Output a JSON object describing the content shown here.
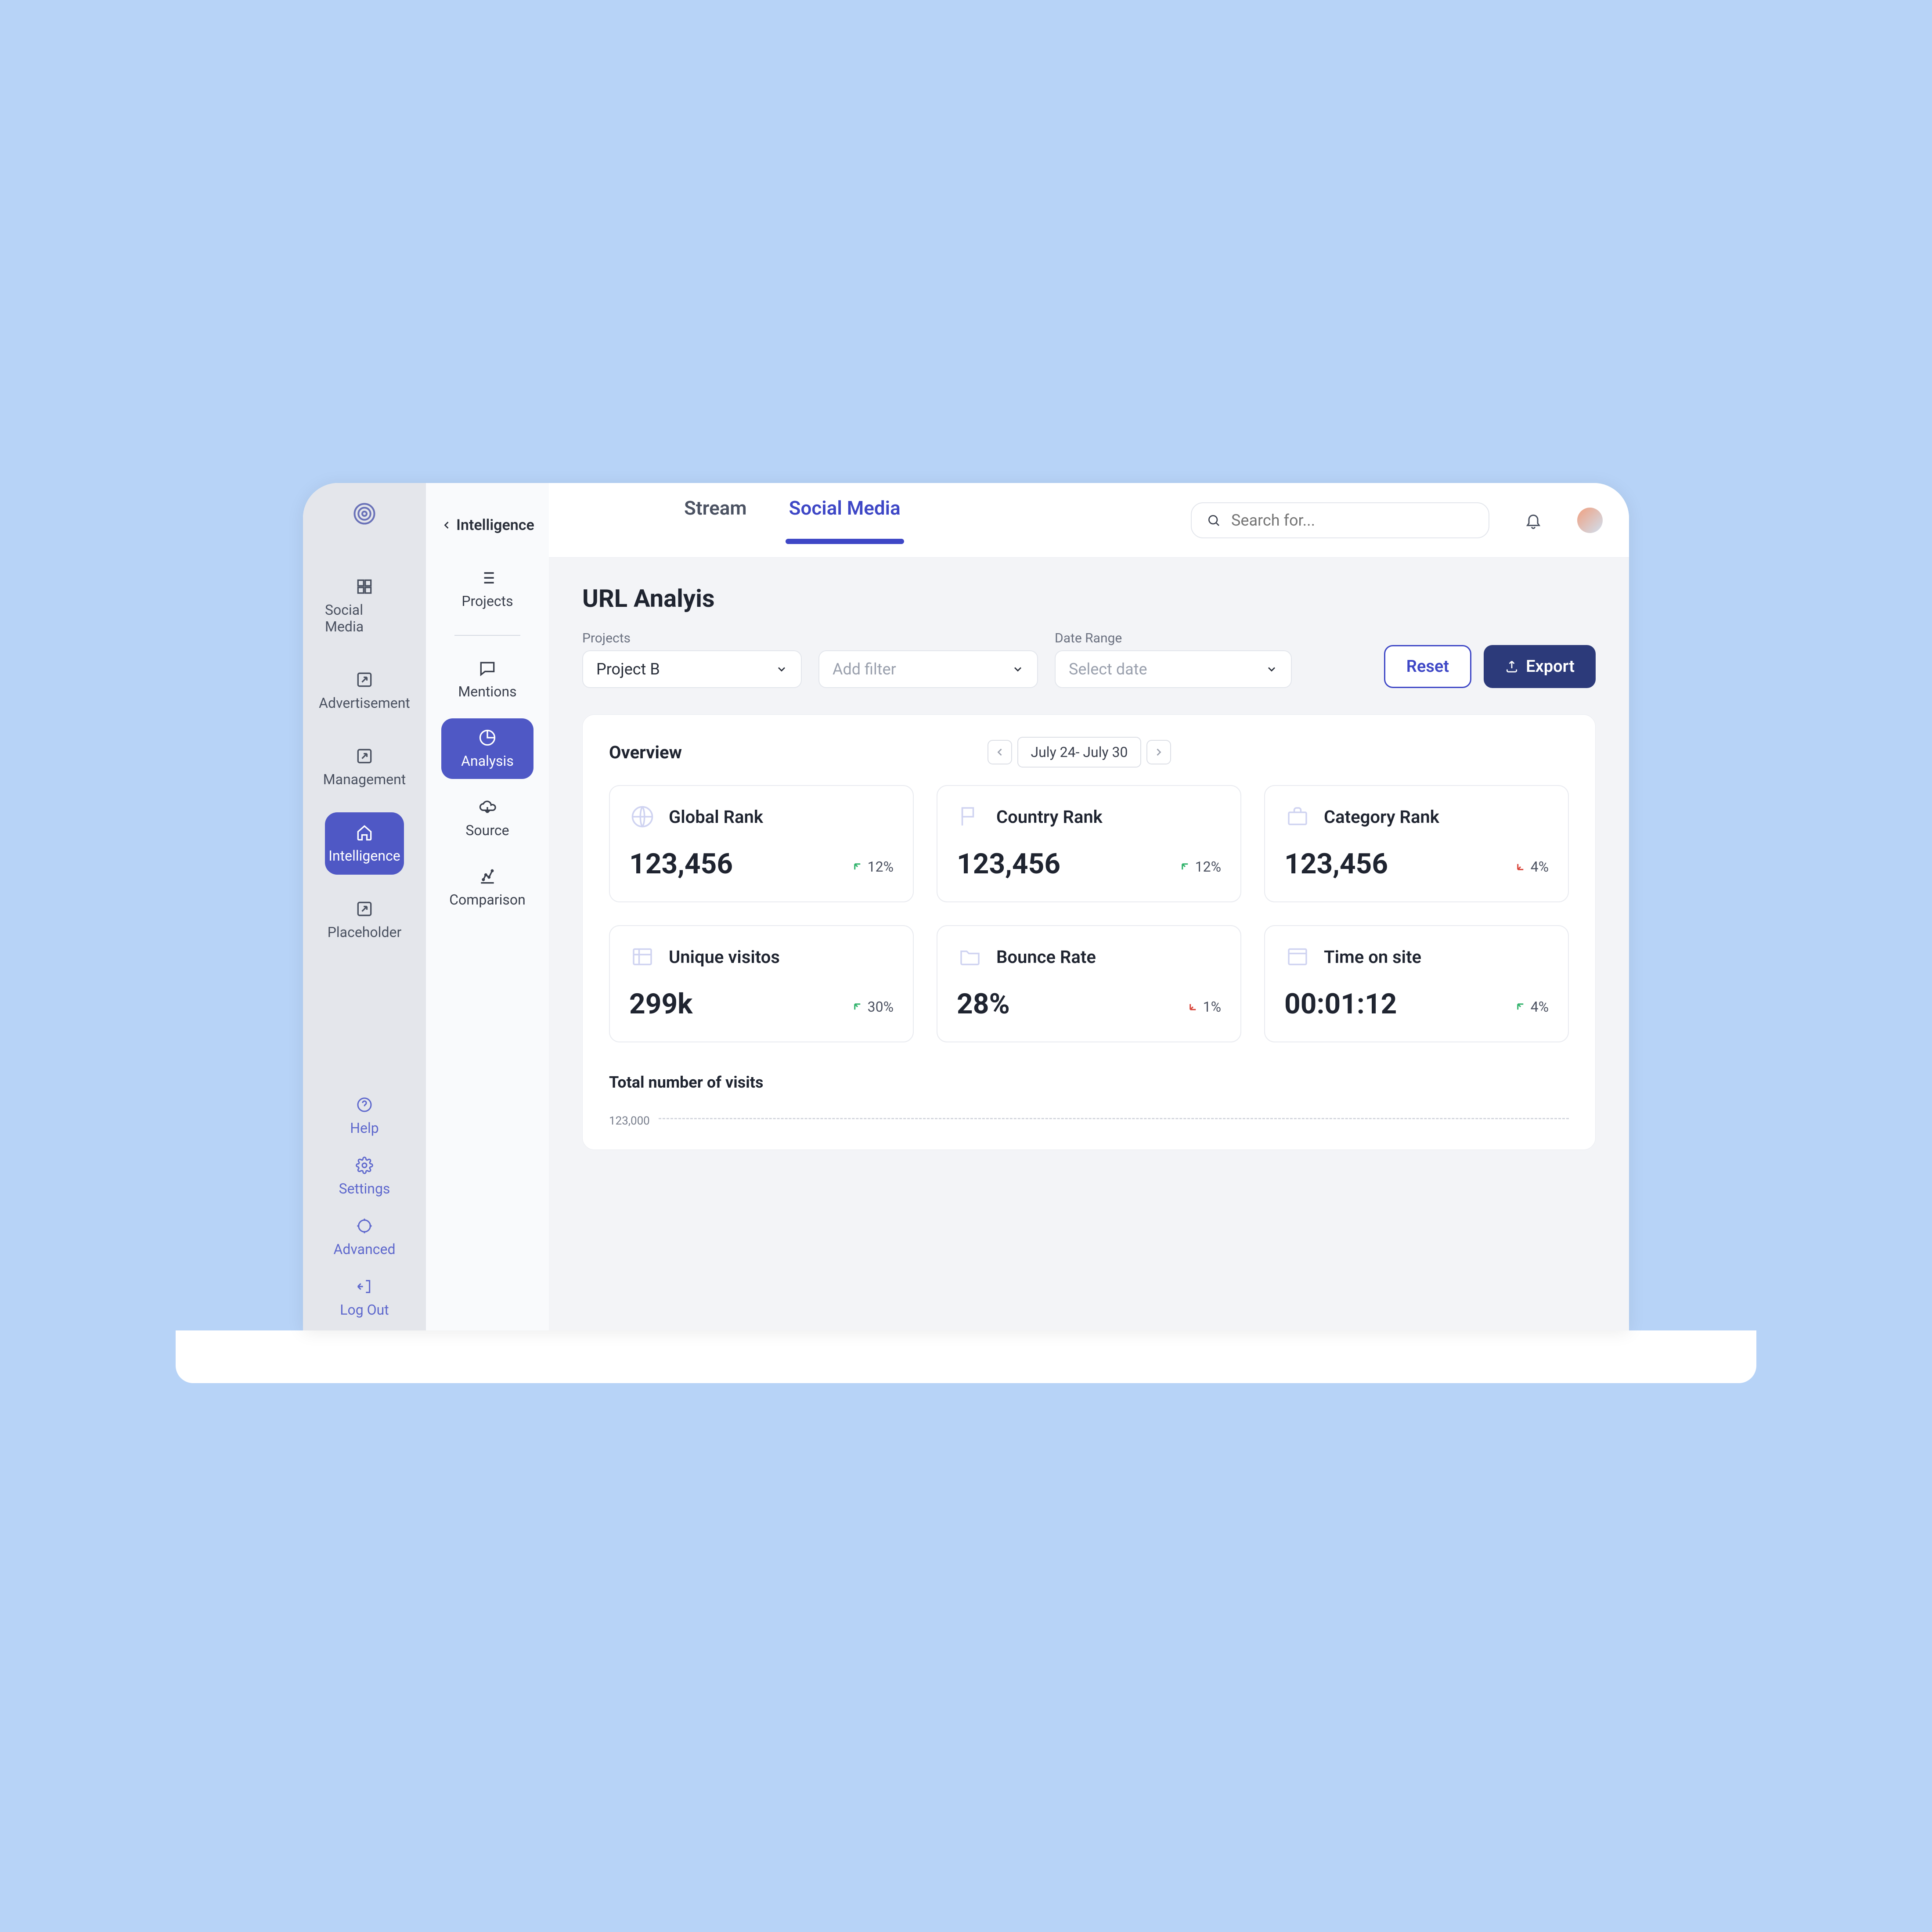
{
  "primarySidebar": {
    "items": [
      {
        "label": "Social Media"
      },
      {
        "label": "Advertisement"
      },
      {
        "label": "Management"
      },
      {
        "label": "Intelligence"
      },
      {
        "label": "Placeholder"
      }
    ],
    "footer": [
      {
        "label": "Help"
      },
      {
        "label": "Settings"
      },
      {
        "label": "Advanced"
      },
      {
        "label": "Log Out"
      }
    ]
  },
  "secondarySidebar": {
    "backLabel": "Intelligence",
    "items": [
      {
        "label": "Projects"
      },
      {
        "label": "Mentions"
      },
      {
        "label": "Analysis"
      },
      {
        "label": "Source"
      },
      {
        "label": "Comparison"
      }
    ]
  },
  "topbar": {
    "tabs": [
      {
        "label": "Stream"
      },
      {
        "label": "Social Media"
      }
    ],
    "searchPlaceholder": "Search for..."
  },
  "page": {
    "title": "URL Analyis",
    "filters": {
      "projectsLabel": "Projects",
      "projectValue": "Project B",
      "addFilter": "Add filter",
      "dateRangeLabel": "Date Range",
      "dateRangePlaceholder": "Select date",
      "resetLabel": "Reset",
      "exportLabel": "Export"
    },
    "overview": {
      "title": "Overview",
      "dateRange": "July 24- July 30",
      "stats": [
        {
          "title": "Global Rank",
          "value": "123,456",
          "trend": "12%",
          "direction": "up"
        },
        {
          "title": "Country Rank",
          "value": "123,456",
          "trend": "12%",
          "direction": "up"
        },
        {
          "title": "Category Rank",
          "value": "123,456",
          "trend": "4%",
          "direction": "down"
        },
        {
          "title": "Unique visitos",
          "value": "299k",
          "trend": "30%",
          "direction": "up"
        },
        {
          "title": "Bounce Rate",
          "value": "28%",
          "trend": "1%",
          "direction": "down"
        },
        {
          "title": "Time on site",
          "value": "00:01:12",
          "trend": "4%",
          "direction": "up"
        }
      ]
    },
    "chart": {
      "title": "Total number of visits",
      "yLabel": "123,000"
    }
  },
  "chart_data": {
    "type": "line",
    "title": "Total number of visits",
    "ylabel": "",
    "xlabel": "",
    "ylim": [
      0,
      123000
    ],
    "categories": [],
    "values": []
  }
}
